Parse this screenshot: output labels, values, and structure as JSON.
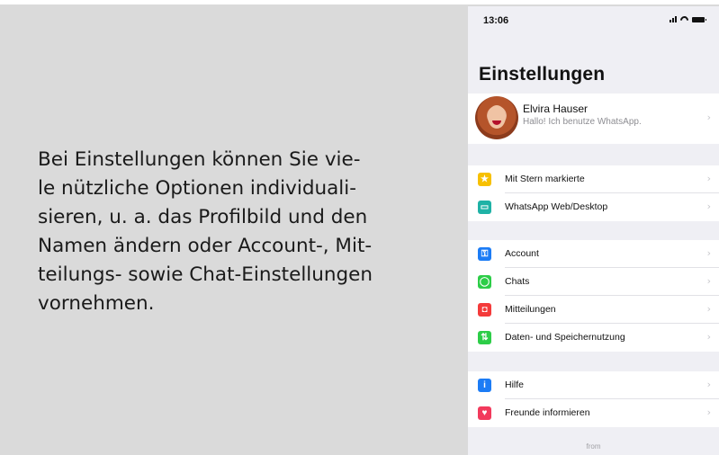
{
  "description": {
    "lines": [
      "Bei Einstellungen können Sie vie-",
      "le nützliche Optionen individuali-",
      "sieren, u. a. das Profilbild und den",
      "Namen ändern oder Account-, Mit-",
      "teilungs- sowie Chat-Einstellungen",
      "vornehmen."
    ]
  },
  "phone": {
    "status": {
      "time": "13:06"
    },
    "title": "Einstellungen",
    "profile": {
      "name": "Elvira Hauser",
      "status": "Hallo! Ich benutze WhatsApp."
    },
    "groups": [
      {
        "items": [
          {
            "label": "Mit Stern markierte",
            "icon": "star-icon",
            "color": "#f7c000",
            "glyph": "★"
          },
          {
            "label": "WhatsApp Web/Desktop",
            "icon": "laptop-icon",
            "color": "#1fb2a6",
            "glyph": "▭"
          }
        ]
      },
      {
        "items": [
          {
            "label": "Account",
            "icon": "key-icon",
            "color": "#1c7cf5",
            "glyph": "⚿"
          },
          {
            "label": "Chats",
            "icon": "whatsapp-icon",
            "color": "#2dcd48",
            "glyph": "◯"
          },
          {
            "label": "Mitteilungen",
            "icon": "notification-icon",
            "color": "#f43b3b",
            "glyph": "◘"
          },
          {
            "label": "Daten- und Speichernutzung",
            "icon": "data-arrows-icon",
            "color": "#2dcd48",
            "glyph": "⇅"
          }
        ]
      },
      {
        "items": [
          {
            "label": "Hilfe",
            "icon": "info-icon",
            "color": "#1c7cf5",
            "glyph": "i"
          },
          {
            "label": "Freunde informieren",
            "icon": "heart-icon",
            "color": "#f23a5c",
            "glyph": "♥"
          }
        ]
      }
    ],
    "footer": "from"
  }
}
